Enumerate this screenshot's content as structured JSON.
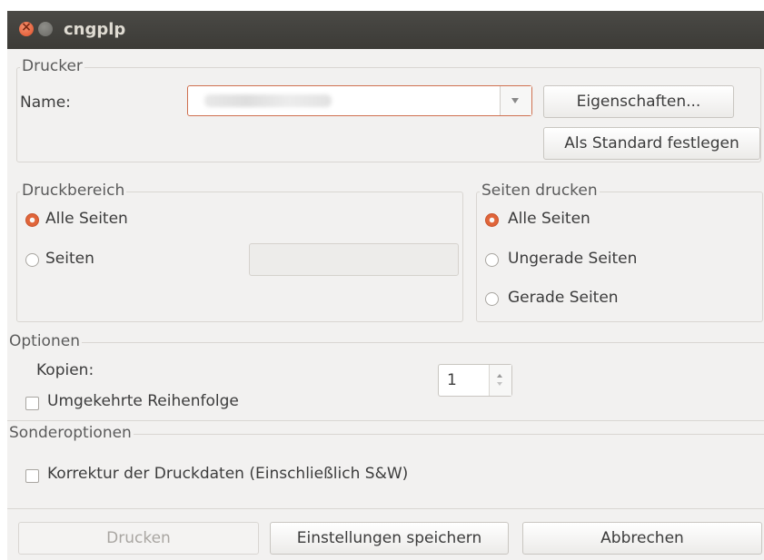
{
  "window": {
    "title": "cngplp"
  },
  "printer": {
    "legend": "Drucker",
    "name_label": "Name:",
    "properties_button": "Eigenschaften...",
    "default_button": "Als Standard festlegen"
  },
  "range": {
    "legend": "Druckbereich",
    "all_pages": "Alle Seiten",
    "pages": "Seiten"
  },
  "print_pages": {
    "legend": "Seiten drucken",
    "all": "Alle Seiten",
    "odd": "Ungerade Seiten",
    "even": "Gerade Seiten"
  },
  "options": {
    "legend": "Optionen",
    "copies_label": "Kopien:",
    "copies_value": "1",
    "reverse_order": "Umgekehrte Reihenfolge"
  },
  "special": {
    "legend": "Sonderoptionen",
    "correction": "Korrektur der Druckdaten (Einschließlich S&W)"
  },
  "footer": {
    "print_button": "Drucken",
    "save_button": "Einstellungen speichern",
    "cancel_button": "Abbrechen"
  }
}
